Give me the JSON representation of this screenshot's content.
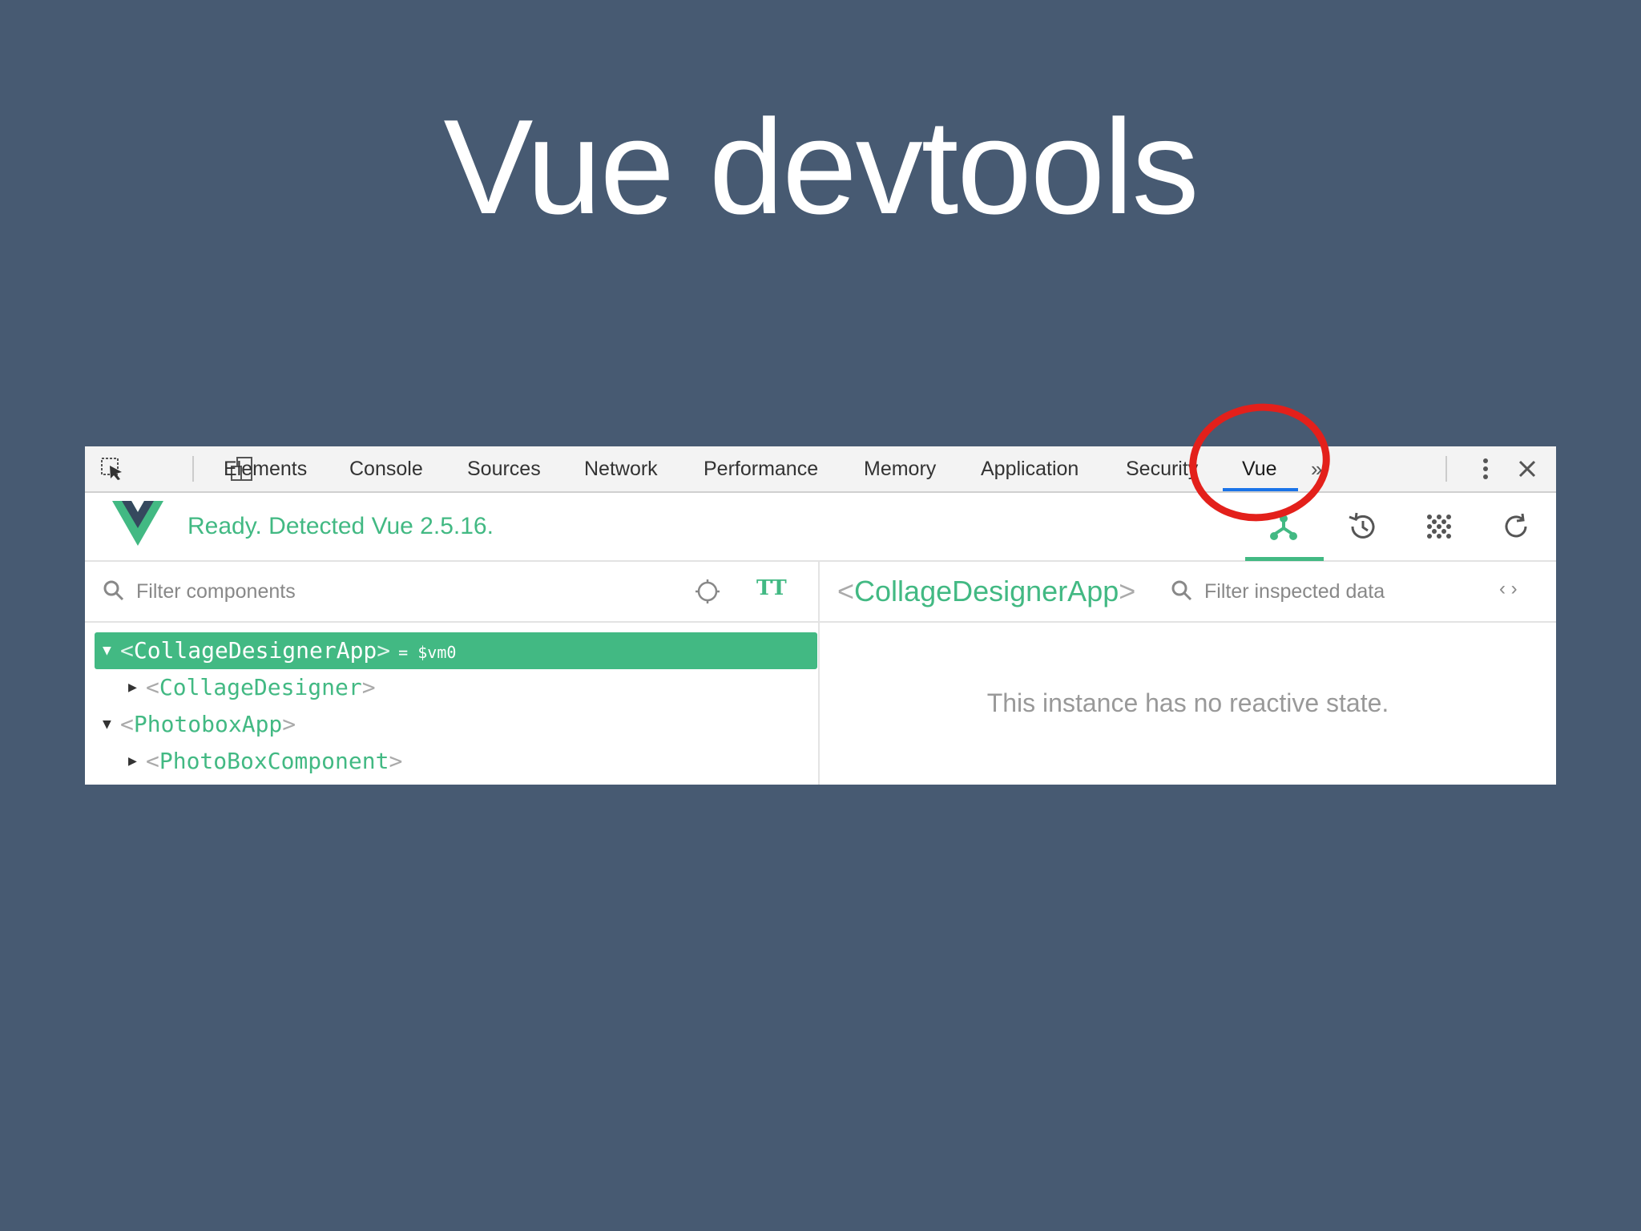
{
  "slide": {
    "title": "Vue devtools"
  },
  "devtools": {
    "tabs": [
      {
        "label": "Elements"
      },
      {
        "label": "Console"
      },
      {
        "label": "Sources"
      },
      {
        "label": "Network"
      },
      {
        "label": "Performance"
      },
      {
        "label": "Memory"
      },
      {
        "label": "Application"
      },
      {
        "label": "Security"
      },
      {
        "label": "Vue"
      }
    ],
    "active_tab": "Vue",
    "more_tabs_label": "»",
    "icons": [
      "inspect-element-icon",
      "device-toolbar-icon",
      "kebab-menu-icon",
      "close-icon"
    ]
  },
  "vue_panel": {
    "status": "Ready. Detected Vue 2.5.16.",
    "header_icons": [
      "components-icon",
      "history-icon",
      "vuex-icon",
      "refresh-icon"
    ],
    "colors": {
      "accent": "#42b983",
      "logo_dark": "#35495e",
      "tab_underline": "#1a73e8",
      "highlight_circle": "#e3201b"
    },
    "filter_components_placeholder": "Filter components",
    "text_size_label": "TT",
    "tree": [
      {
        "open_bracket": "<",
        "name": "CollageDesignerApp",
        "close_bracket": ">",
        "suffix": "= $vm0",
        "expanded": true,
        "selected": true
      },
      {
        "open_bracket": "<",
        "name": "CollageDesigner",
        "close_bracket": ">",
        "expanded": false,
        "selected": false
      },
      {
        "open_bracket": "<",
        "name": "PhotoboxApp",
        "close_bracket": ">",
        "expanded": true,
        "selected": false
      },
      {
        "open_bracket": "<",
        "name": "PhotoBoxComponent",
        "close_bracket": ">",
        "expanded": false,
        "selected": false
      }
    ],
    "inspector": {
      "open_bracket": "<",
      "name": "CollageDesignerApp",
      "close_bracket": ">",
      "filter_placeholder": "Filter inspected data",
      "code_toggle_label": "‹ ›",
      "empty_message": "This instance has no reactive state."
    }
  }
}
